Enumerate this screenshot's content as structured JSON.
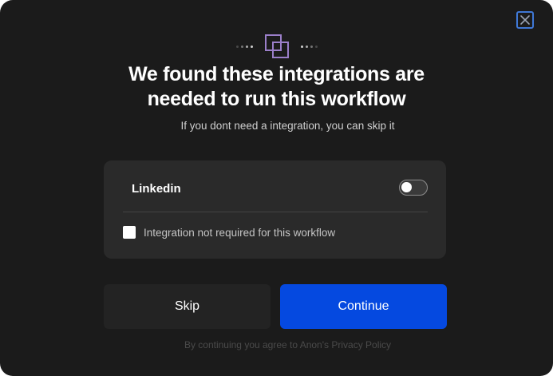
{
  "dialog": {
    "title_line1": "We found these integrations are",
    "title_line2": "needed to run this workflow",
    "subtitle": "If you dont need a integration, you can skip it",
    "close_icon": "close-icon",
    "hero_icon": "overlapping-squares-icon"
  },
  "integrations": [
    {
      "name": "Linkedin",
      "enabled": false,
      "not_required_label": "Integration not required for this workflow",
      "not_required_checked": false
    }
  ],
  "buttons": {
    "skip_label": "Skip",
    "continue_label": "Continue"
  },
  "footer": {
    "text": "By continuing you agree to Anon's Privacy Policy"
  },
  "colors": {
    "background": "#1b1b1b",
    "card": "#2a2a2a",
    "primary": "#0549e0",
    "accent_icon": "#9b7fc9"
  }
}
